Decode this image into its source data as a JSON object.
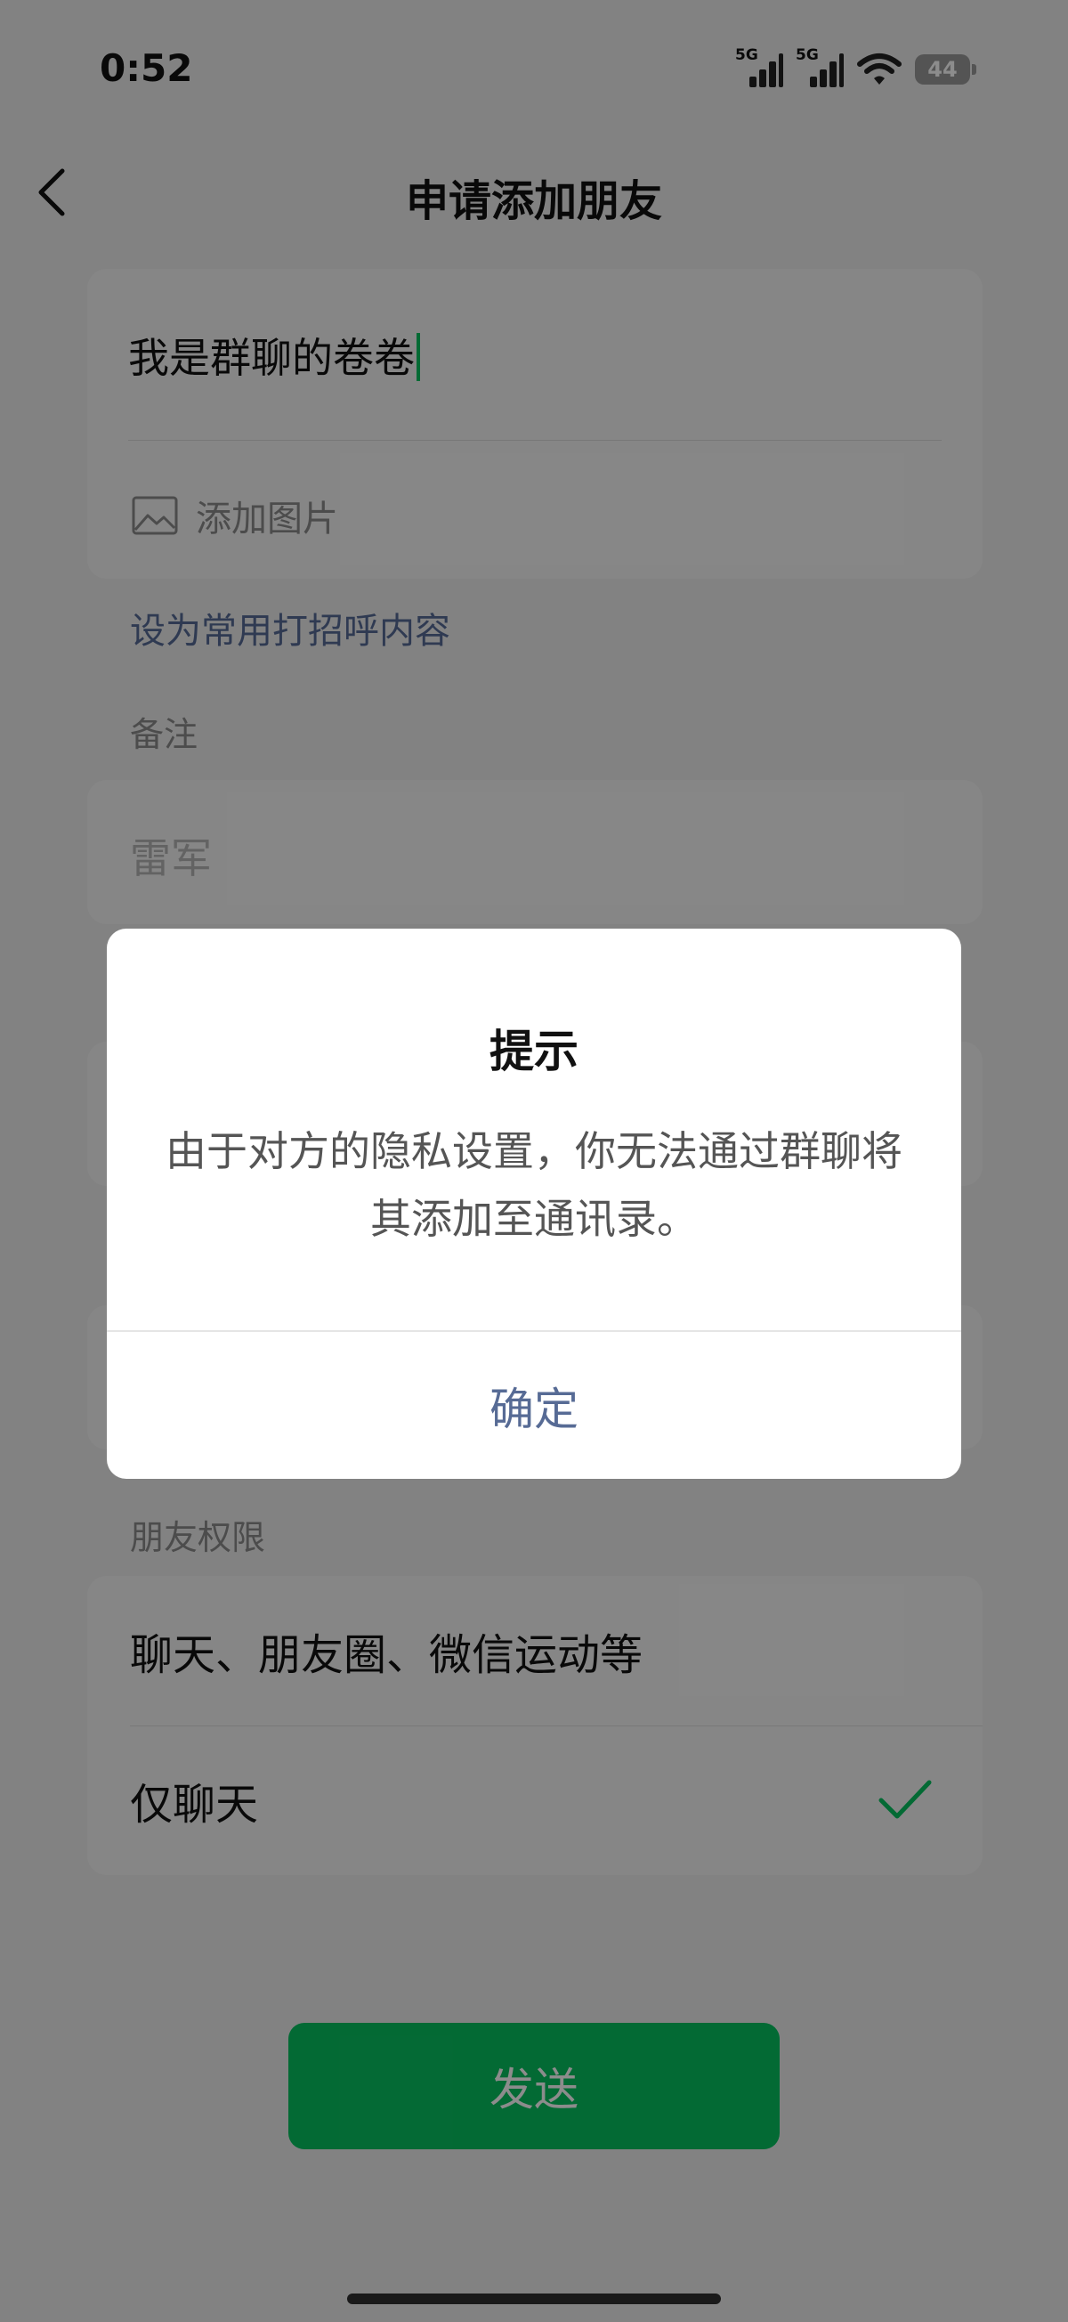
{
  "status_bar": {
    "time": "0:52",
    "signal_1_label": "5G",
    "signal_2_label": "5G",
    "battery": "44",
    "icons": [
      "signal-icon",
      "signal-icon",
      "wifi-icon",
      "battery-icon"
    ]
  },
  "nav": {
    "title": "申请添加朋友",
    "back_icon": "chevron-left-icon"
  },
  "greeting": {
    "value": "我是群聊的卷卷",
    "add_image_label": "添加图片",
    "add_image_icon": "image-icon"
  },
  "set_default_greeting_link": "设为常用打招呼内容",
  "remark": {
    "label": "备注",
    "value": "雷军"
  },
  "permissions": {
    "label": "朋友权限",
    "options": [
      {
        "label": "聊天、朋友圈、微信运动等",
        "selected": false
      },
      {
        "label": "仅聊天",
        "selected": true
      }
    ],
    "check_icon": "checkmark-icon"
  },
  "send_button_label": "发送",
  "dialog": {
    "title": "提示",
    "message": "由于对方的隐私设置，你无法通过群聊将其添加至通讯录。",
    "confirm_label": "确定"
  },
  "colors": {
    "accent_green": "#07c160",
    "link_blue": "#576b95",
    "background": "#ededed",
    "overlay": "rgba(0,0,0,0.45)"
  }
}
